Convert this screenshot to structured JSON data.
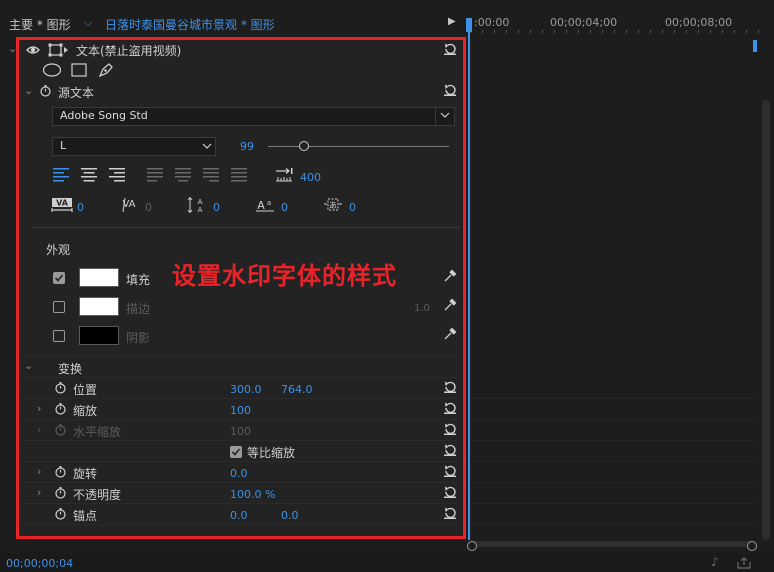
{
  "header": {
    "master_tab": "主要 * 图形",
    "sequence_tab": "日落时泰国曼谷城市景观 * 图形",
    "timecodes": [
      ":00:00",
      "00;00;04;00",
      "00;00;08;00"
    ]
  },
  "layer": {
    "title": "文本(禁止盗用视频)"
  },
  "source_text": {
    "section_label": "源文本",
    "font_family": "Adobe Song Std",
    "font_style": "L",
    "font_size": "99",
    "size_slider_fraction": 0.2,
    "tab_stop_value": "400",
    "tracking": "0",
    "kerning": "0",
    "leading": "0",
    "baseline_shift": "0",
    "tsume": "0"
  },
  "appearance": {
    "section_label": "外观",
    "fill_label": "填充",
    "fill_color": "#ffffff",
    "fill_checked": true,
    "stroke_label": "描边",
    "stroke_color": "#ffffff",
    "stroke_checked": false,
    "stroke_width": "1.0",
    "shadow_label": "阴影",
    "shadow_color": "#000000",
    "shadow_checked": false
  },
  "annotation": {
    "text": "设置水印字体的样式",
    "color": "#e8242a"
  },
  "transform": {
    "section_label": "变换",
    "position_label": "位置",
    "position_x": "300.0",
    "position_y": "764.0",
    "scale_label": "缩放",
    "scale_value": "100",
    "hscale_label": "水平缩放",
    "hscale_value": "100",
    "uniform_label": "等比缩放",
    "uniform_checked": true,
    "rotation_label": "旋转",
    "rotation_value": "0.0",
    "opacity_label": "不透明度",
    "opacity_value": "100.0 %",
    "anchor_label": "锚点",
    "anchor_x": "0.0",
    "anchor_y": "0.0"
  },
  "footer": {
    "timecode": "00;00;00;04"
  },
  "colors": {
    "accent": "#3d92e8",
    "highlight_box": "#e8242a"
  }
}
